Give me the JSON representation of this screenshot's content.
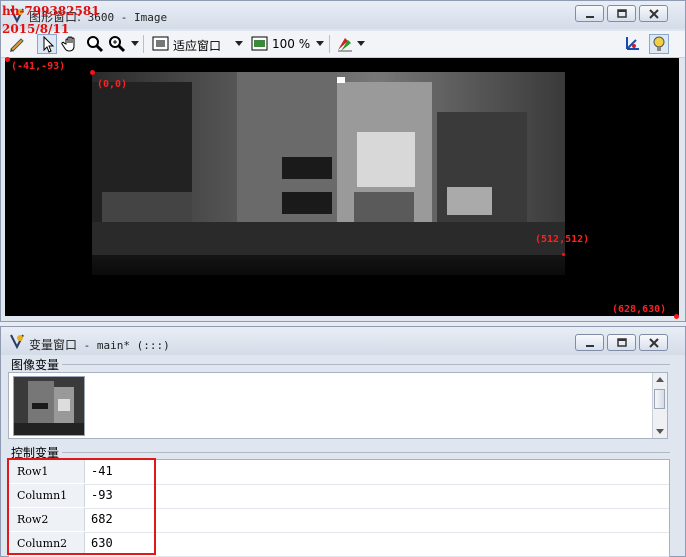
{
  "watermark": {
    "line1": "hh-799382581",
    "line2": "2015/8/11"
  },
  "graphics_window": {
    "title_label": "图形窗口:",
    "title_rest": " 3600 - Image",
    "toolbar": {
      "fit_label": "适应窗口",
      "zoom_label": "100 %"
    },
    "coords": {
      "top_left": "(-41,-93)",
      "origin": "(0,0)",
      "image_corner": "(512,512)",
      "bottom_right": "(628,630)"
    }
  },
  "variable_window": {
    "title_label": "变量窗口",
    "title_rest": " - main* (:::)",
    "image_vars_label": "图像变量",
    "control_vars_label": "控制变量",
    "rows": [
      {
        "name": "Row1",
        "value": "-41"
      },
      {
        "name": "Column1",
        "value": "-93"
      },
      {
        "name": "Row2",
        "value": "682"
      },
      {
        "name": "Column2",
        "value": "630"
      }
    ]
  },
  "colors": {
    "annotation_red": "#e01010",
    "canvas": "#000000"
  }
}
